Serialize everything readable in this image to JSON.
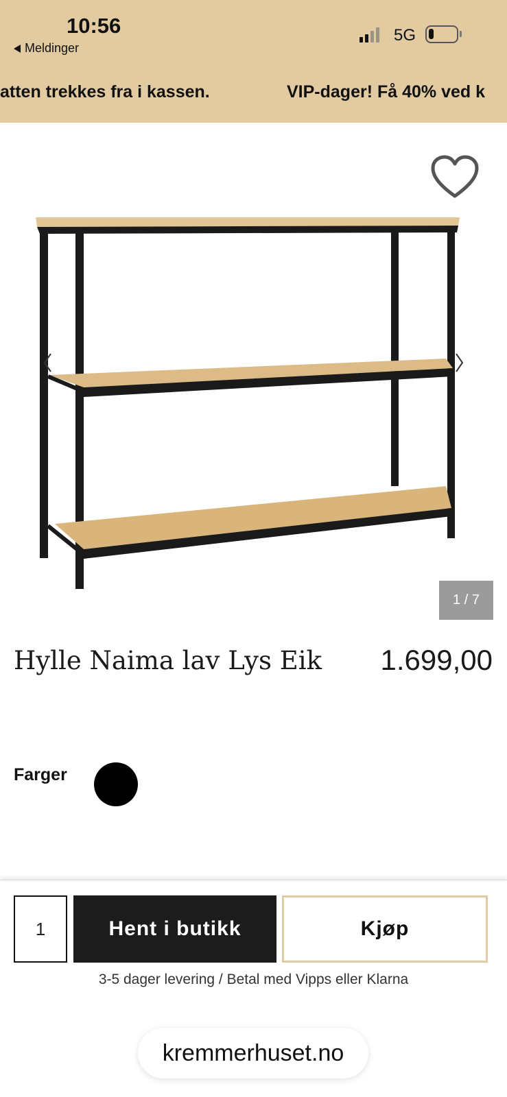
{
  "status_bar": {
    "time": "10:56",
    "back_label": "Meldinger",
    "network": "5G",
    "signal_bars": 2,
    "battery_level": 0.15
  },
  "promo": {
    "left_text": "atten trekkes fra i kassen.",
    "right_text": "VIP-dager! Få 40% ved k",
    "background": "#e2cba1"
  },
  "gallery": {
    "wishlist_icon": "heart-outline-icon",
    "counter": "1 / 7",
    "prev_icon": "chevron-left-icon",
    "next_icon": "chevron-right-icon"
  },
  "product": {
    "title": "Hylle Naima lav Lys Eik",
    "price": "1.699,00"
  },
  "colors": {
    "label": "Farger",
    "swatches": [
      "#000000"
    ]
  },
  "buy_bar": {
    "quantity": "1",
    "pickup_label": "Hent i butikk",
    "buy_label": "Kjøp",
    "delivery_info": "3-5 dager levering / Betal med Vipps eller Klarna",
    "accent": "#e2cba1"
  },
  "browser": {
    "domain": "kremmerhuset.no"
  }
}
